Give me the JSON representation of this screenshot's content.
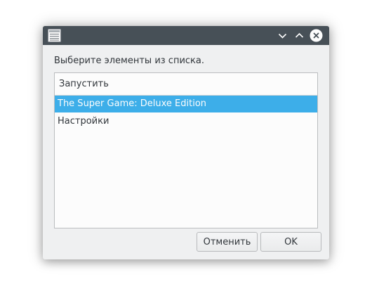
{
  "window": {
    "title": "",
    "icons": {
      "app": "list-window-icon",
      "minimize": "chevron-down-icon",
      "maximize": "chevron-up-icon",
      "close": "close-icon"
    }
  },
  "prompt": "Выберите элементы из списка.",
  "list": {
    "header": "Запустить",
    "items": [
      {
        "label": "The Super Game: Deluxe Edition",
        "selected": true
      },
      {
        "label": "Настройки",
        "selected": false
      }
    ]
  },
  "buttons": {
    "cancel": "Отменить",
    "ok": "OK"
  },
  "colors": {
    "titlebar": "#475057",
    "selection": "#3daee9",
    "window_bg": "#eff0f1",
    "text": "#31363b"
  }
}
